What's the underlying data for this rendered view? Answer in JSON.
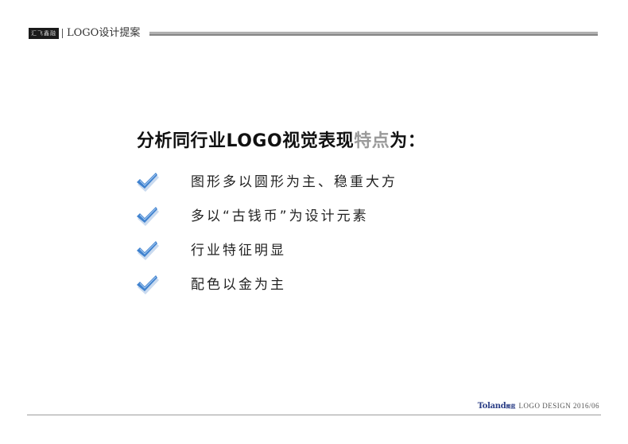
{
  "header": {
    "logo_text": "汇飞鑫融",
    "title": "LOGO设计提案"
  },
  "heading": {
    "main": "分析同行业LOGO视觉表现",
    "highlight": "特点",
    "tail": "为："
  },
  "bullets": [
    {
      "icon": "checkmark-icon",
      "text": "图形多以圆形为主、稳重大方"
    },
    {
      "icon": "checkmark-icon",
      "text": "多以“古钱币”为设计元素"
    },
    {
      "icon": "checkmark-icon",
      "text": "行业特征明显"
    },
    {
      "icon": "checkmark-icon",
      "text": "配色以金为主"
    }
  ],
  "footer": {
    "brand": "Toland",
    "brand_cn": "图蓝",
    "text": "LOGO DESIGN  2016/06"
  },
  "colors": {
    "highlight": "#9a9a9a",
    "check_blue": "#3f82cf",
    "brand_blue": "#2b3e86"
  }
}
